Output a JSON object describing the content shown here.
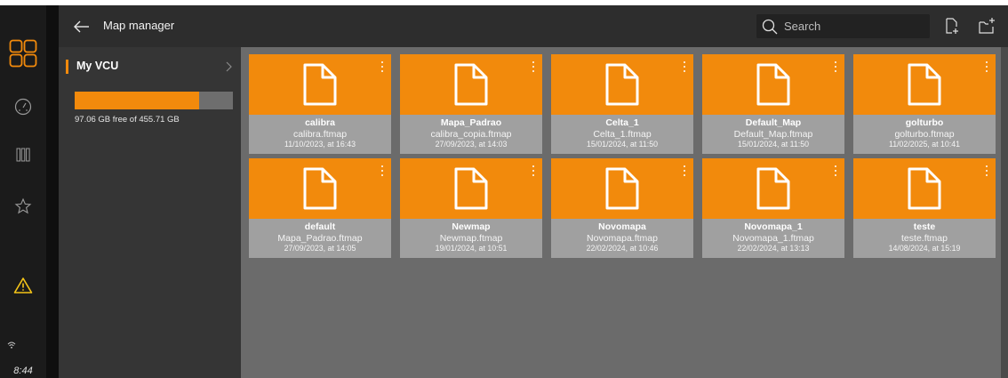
{
  "app": {
    "title": "Map manager",
    "time": "8:44"
  },
  "search": {
    "placeholder": "Search"
  },
  "sidebar": {
    "device_label": "My VCU",
    "storage_text": "97.06 GB free of 455.71 GB",
    "storage_used_fraction": 0.787
  },
  "colors": {
    "accent": "#f28a0c",
    "warning": "#f5c518"
  },
  "maps": [
    {
      "name": "calibra",
      "file": "calibra.ftmap",
      "date": "11/10/2023, at 16:43"
    },
    {
      "name": "Mapa_Padrao",
      "file": "calibra_copia.ftmap",
      "date": "27/09/2023, at 14:03"
    },
    {
      "name": "Celta_1",
      "file": "Celta_1.ftmap",
      "date": "15/01/2024, at 11:50"
    },
    {
      "name": "Default_Map",
      "file": "Default_Map.ftmap",
      "date": "15/01/2024, at 11:50"
    },
    {
      "name": "golturbo",
      "file": "golturbo.ftmap",
      "date": "11/02/2025, at 10:41"
    },
    {
      "name": "default",
      "file": "Mapa_Padrao.ftmap",
      "date": "27/09/2023, at 14:05"
    },
    {
      "name": "Newmap",
      "file": "Newmap.ftmap",
      "date": "19/01/2024, at 10:51"
    },
    {
      "name": "Novomapa",
      "file": "Novomapa.ftmap",
      "date": "22/02/2024, at 10:46"
    },
    {
      "name": "Novomapa_1",
      "file": "Novomapa_1.ftmap",
      "date": "22/02/2024, at 13:13"
    },
    {
      "name": "teste",
      "file": "teste.ftmap",
      "date": "14/08/2024, at 15:19"
    }
  ]
}
